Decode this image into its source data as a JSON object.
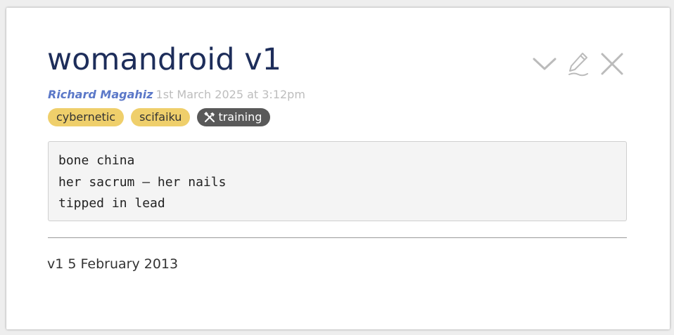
{
  "post": {
    "title": "womandroid v1",
    "author": "Richard Magahiz",
    "timestamp": "1st March 2025 at 3:12pm",
    "tags": [
      {
        "label": "cybernetic",
        "color": "#efcf6b"
      },
      {
        "label": "scifaiku",
        "color": "#efcf6b"
      },
      {
        "label": "training",
        "color": "#595959",
        "icon": "tools-icon"
      }
    ],
    "poem_lines": [
      "bone china",
      "her sacrum — her nails",
      "tipped in lead"
    ],
    "footer_note": "v1 5 February 2013"
  },
  "actions": {
    "collapse_icon": "chevron-down-icon",
    "edit_icon": "pencil-icon",
    "close_icon": "close-icon"
  },
  "colors": {
    "title": "#1d2d5a",
    "author": "#5b78c8",
    "timestamp": "#bdbdbd",
    "tag_yellow": "#efcf6b",
    "tag_dark": "#595959",
    "icon_gray": "#bbbbbb"
  }
}
